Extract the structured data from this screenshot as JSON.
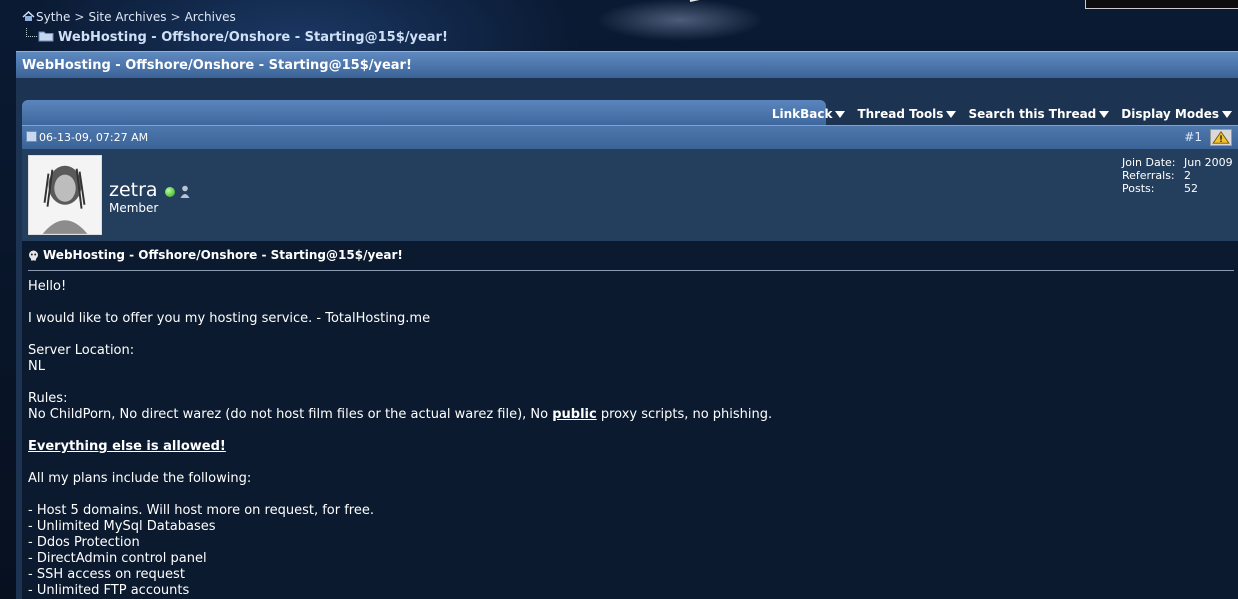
{
  "breadcrumb": {
    "items": [
      "Sythe",
      "Site Archives",
      "Archives"
    ],
    "separator": ">",
    "current": "WebHosting - Offshore/Onshore - Starting@15$/year!"
  },
  "thread": {
    "title": "WebHosting - Offshore/Onshore - Starting@15$/year!"
  },
  "toolbar": {
    "linkback": "LinkBack",
    "thread_tools": "Thread Tools",
    "search_thread": "Search this Thread",
    "display_modes": "Display Modes"
  },
  "post": {
    "date": "06-13-09, 07:27 AM",
    "number": "#1",
    "title": "WebHosting - Offshore/Onshore - Starting@15$/year!",
    "user": {
      "name": "zetra",
      "title": "Member",
      "join_label": "Join Date:",
      "join_value": "Jun 2009",
      "referrals_label": "Referrals:",
      "referrals_value": "2",
      "posts_label": "Posts:",
      "posts_value": "52",
      "online": true
    },
    "body": {
      "greeting": "Hello!",
      "intro": "I would like to offer you my hosting service. - TotalHosting.me",
      "location_label": "Server Location:",
      "location_value": "NL",
      "rules_label": "Rules:",
      "rules_pre": "No ChildPorn, No direct warez (do not host film files or the actual warez file), No ",
      "rules_emph": "public",
      "rules_post": " proxy scripts, no phishing.",
      "allowed": "Everything else is allowed!",
      "plans_intro": "All my plans include the following:",
      "features": [
        "- Host 5 domains. Will host more on request, for free.",
        "- Unlimited MySql Databases",
        "- Ddos Protection",
        "- DirectAdmin control panel",
        "- SSH access on request",
        "- Unlimited FTP accounts"
      ]
    }
  },
  "colors": {
    "title_bar": "#4a74a9",
    "panel": "#1c3352",
    "user_panel": "#243e5e",
    "post_body": "#0b1a2e",
    "online": "#29a318"
  }
}
